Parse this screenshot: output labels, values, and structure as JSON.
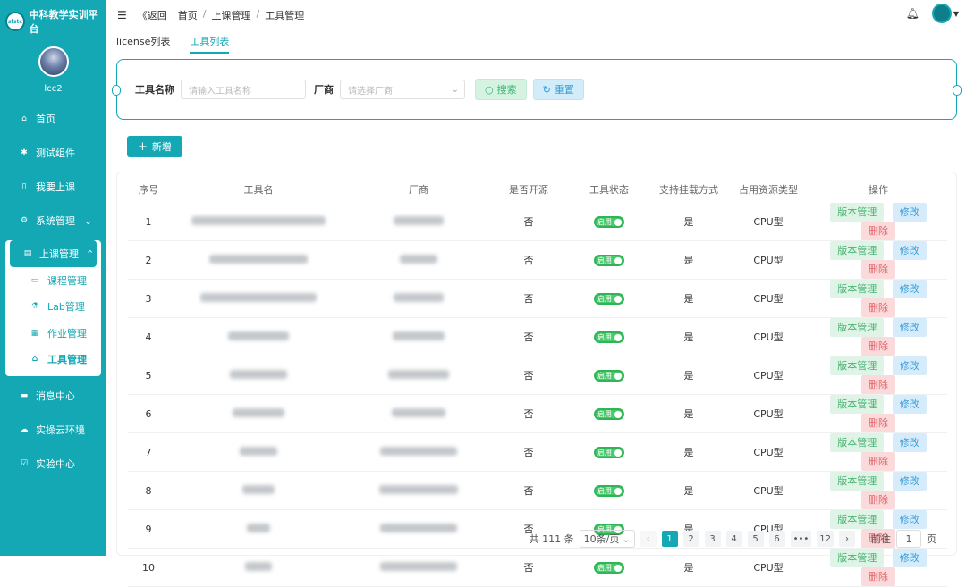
{
  "app": {
    "title": "中科教学实训平台",
    "logo_text": "sfstc"
  },
  "user": {
    "name": "lcc2"
  },
  "sidebar": {
    "items": [
      {
        "label": "首页",
        "icon": "home-icon"
      },
      {
        "label": "测试组件",
        "icon": "component-icon"
      },
      {
        "label": "我要上课",
        "icon": "class-icon"
      },
      {
        "label": "系统管理",
        "icon": "settings-icon",
        "has_arrow": true
      }
    ],
    "group": {
      "label": "上课管理",
      "icon": "course-manage-icon",
      "children": [
        {
          "label": "课程管理",
          "icon": "course-icon"
        },
        {
          "label": "Lab管理",
          "icon": "lab-icon"
        },
        {
          "label": "作业管理",
          "icon": "homework-icon"
        },
        {
          "label": "工具管理",
          "icon": "tool-icon",
          "active": true
        }
      ]
    },
    "items_after": [
      {
        "label": "消息中心",
        "icon": "message-icon"
      },
      {
        "label": "实操云环境",
        "icon": "cloud-icon"
      },
      {
        "label": "实验中心",
        "icon": "lab-center-icon"
      }
    ]
  },
  "topbar": {
    "back": "《返回",
    "breadcrumb": [
      "首页",
      "上课管理",
      "工具管理"
    ],
    "separator": "/"
  },
  "tabs": [
    {
      "label": "license列表",
      "active": false
    },
    {
      "label": "工具列表",
      "active": true
    }
  ],
  "search": {
    "name_label": "工具名称",
    "name_placeholder": "请输入工具名称",
    "vendor_label": "厂商",
    "vendor_placeholder": "请选择厂商",
    "search_btn": "搜索",
    "reset_btn": "重置"
  },
  "add_btn": "新增",
  "table": {
    "columns": [
      "序号",
      "工具名",
      "厂商",
      "是否开源",
      "工具状态",
      "支持挂载方式",
      "占用资源类型",
      "操作"
    ],
    "rows": [
      {
        "index": "1",
        "open_source": "否",
        "status": "启用",
        "mount": "是",
        "resource": "CPU型"
      },
      {
        "index": "2",
        "open_source": "否",
        "status": "启用",
        "mount": "是",
        "resource": "CPU型"
      },
      {
        "index": "3",
        "open_source": "否",
        "status": "启用",
        "mount": "是",
        "resource": "CPU型"
      },
      {
        "index": "4",
        "open_source": "否",
        "status": "启用",
        "mount": "是",
        "resource": "CPU型"
      },
      {
        "index": "5",
        "open_source": "否",
        "status": "启用",
        "mount": "是",
        "resource": "CPU型"
      },
      {
        "index": "6",
        "open_source": "否",
        "status": "启用",
        "mount": "是",
        "resource": "CPU型"
      },
      {
        "index": "7",
        "open_source": "否",
        "status": "启用",
        "mount": "是",
        "resource": "CPU型"
      },
      {
        "index": "8",
        "open_source": "否",
        "status": "启用",
        "mount": "是",
        "resource": "CPU型"
      },
      {
        "index": "9",
        "open_source": "否",
        "status": "启用",
        "mount": "是",
        "resource": "CPU型"
      },
      {
        "index": "10",
        "open_source": "否",
        "status": "启用",
        "mount": "是",
        "resource": "CPU型"
      }
    ],
    "actions": {
      "version": "版本管理",
      "edit": "修改",
      "delete": "删除"
    }
  },
  "pagination": {
    "total": "共 111 条",
    "page_size": "10条/页",
    "pages": [
      "1",
      "2",
      "3",
      "4",
      "5",
      "6",
      "•••",
      "12"
    ],
    "current": "1",
    "goto_label": "前往",
    "goto_value": "1",
    "goto_suffix": "页"
  },
  "colors": {
    "primary": "#14a8b5",
    "success": "#46b271",
    "info": "#3b9ddb",
    "danger": "#e0666a"
  }
}
